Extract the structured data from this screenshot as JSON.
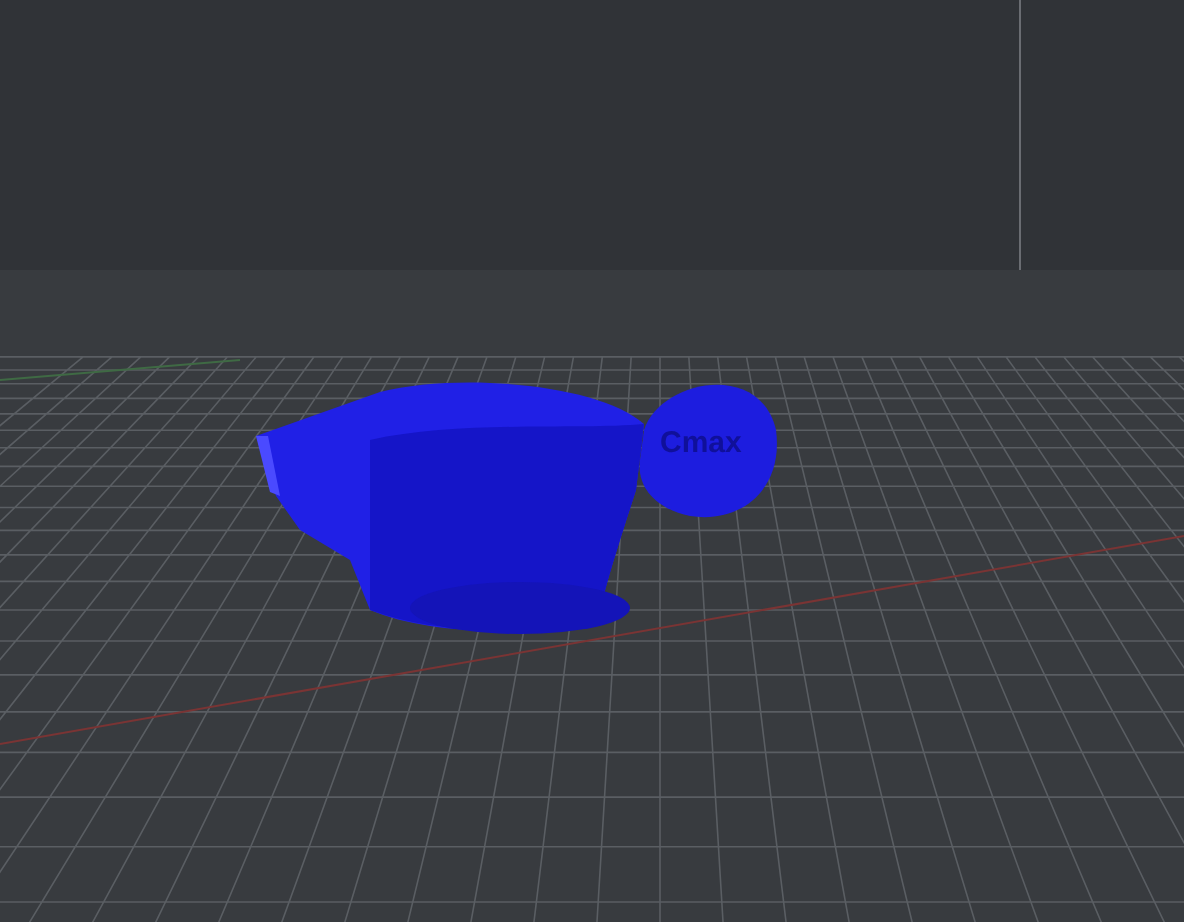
{
  "viewport": {
    "model": {
      "label": "Cmax"
    }
  }
}
